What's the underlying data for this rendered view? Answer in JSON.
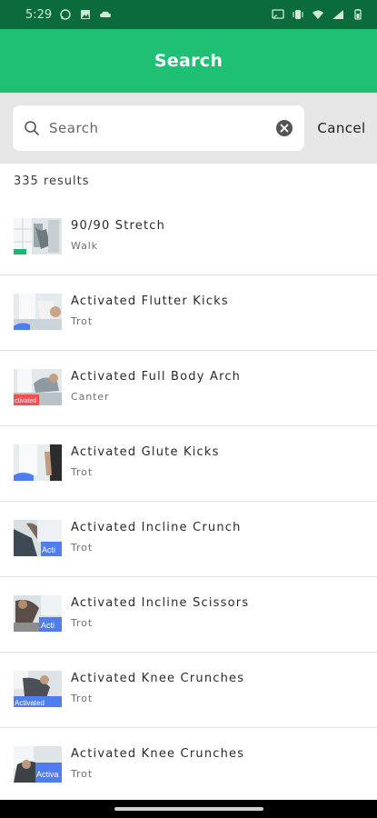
{
  "status_bar": {
    "time": "5:29",
    "left_icons": [
      "whatsapp-icon",
      "gallery-icon",
      "cloud-icon"
    ],
    "right_icons": [
      "cast-icon",
      "vibrate-icon",
      "wifi-icon",
      "signal-icon",
      "battery-icon"
    ]
  },
  "header": {
    "title": "Search"
  },
  "search": {
    "placeholder": "Search",
    "value": "",
    "cancel_label": "Cancel"
  },
  "results_count": "335 results",
  "results": [
    {
      "title": "90/90 Stretch",
      "subtitle": "Walk",
      "badge_color": "#21b573",
      "badge_text": ""
    },
    {
      "title": "Activated Flutter Kicks",
      "subtitle": "Trot",
      "badge_color": "#4f7df0",
      "badge_text": ""
    },
    {
      "title": "Activated Full Body Arch",
      "subtitle": "Canter",
      "badge_color": "#f05050",
      "badge_text": "ctivated"
    },
    {
      "title": "Activated Glute Kicks",
      "subtitle": "Trot",
      "badge_color": "#4f7df0",
      "badge_text": ""
    },
    {
      "title": "Activated Incline Crunch",
      "subtitle": "Trot",
      "badge_color": "#4f7df0",
      "badge_text": "Acti"
    },
    {
      "title": "Activated Incline Scissors",
      "subtitle": "Trot",
      "badge_color": "#4f7df0",
      "badge_text": "Acti"
    },
    {
      "title": "Activated Knee Crunches",
      "subtitle": "Trot",
      "badge_color": "#4f7df0",
      "badge_text": "Activated"
    },
    {
      "title": "Activated Knee Crunches",
      "subtitle": "Trot",
      "badge_color": "#4f7df0",
      "badge_text": "Activa"
    }
  ],
  "colors": {
    "status_bar": "#0b6b3a",
    "header": "#1fbf74",
    "search_area": "#e6e6e6"
  }
}
